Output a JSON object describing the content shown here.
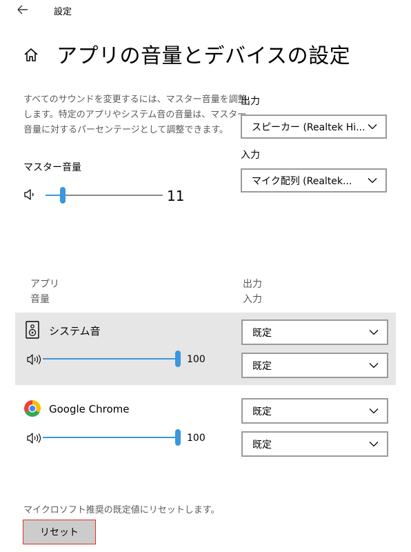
{
  "window": {
    "title": "設定"
  },
  "page": {
    "title": "アプリの音量とデバイスの設定"
  },
  "master": {
    "description": "すべてのサウンドを変更するには、マスター音量を調整します。特定のアプリやシステム音の音量は、マスター音量に対するパーセンテージとして調整できます。",
    "label": "マスター音量",
    "value": "11",
    "level": 0.11
  },
  "output": {
    "label": "出力",
    "selected": "スピーカー (Realtek Hi..."
  },
  "input": {
    "label": "入力",
    "selected": "マイク配列 (Realtek..."
  },
  "app_table": {
    "header_left_1": "アプリ",
    "header_left_2": "音量",
    "header_right_1": "出力",
    "header_right_2": "入力",
    "apps": [
      {
        "name": "システム音",
        "icon": "speaker-device-icon",
        "volume": "100",
        "level": 1.0,
        "output": "既定",
        "input": "既定"
      },
      {
        "name": "Google Chrome",
        "icon": "chrome-icon",
        "volume": "100",
        "level": 1.0,
        "output": "既定",
        "input": "既定"
      }
    ]
  },
  "reset": {
    "description": "マイクロソフト推奨の既定値にリセットします。",
    "button_label": "リセット"
  },
  "colors": {
    "accent": "#3a96dd",
    "row_highlight": "#e6e6e6",
    "reset_border": "#d93025"
  }
}
